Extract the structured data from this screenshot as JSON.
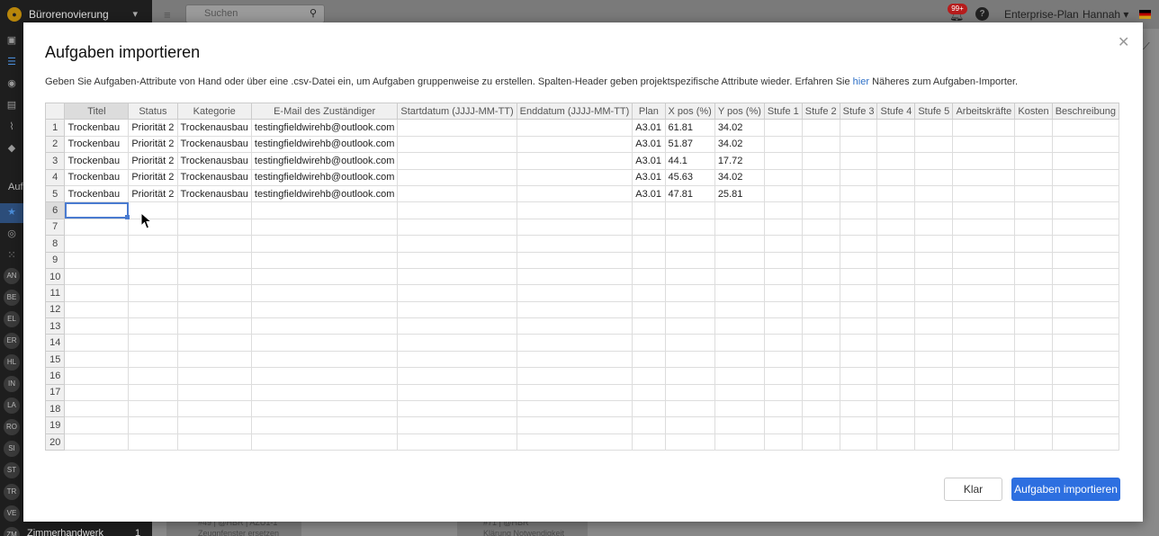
{
  "app": {
    "project_name": "Bürorenovierung",
    "search_placeholder": "Suchen",
    "notification_count": "99+",
    "plan": "Enterprise-Plan",
    "user": "Hannah",
    "sidebar_heading": "Auf",
    "sidebar_badges": [
      "AN",
      "BE",
      "EL",
      "ER",
      "HL",
      "IN",
      "LA",
      "RO",
      "SI",
      "ST",
      "TR",
      "VE",
      "ZM"
    ],
    "sidebar_bottom_item": "Zimmerhandwerk",
    "sidebar_bottom_count": "1",
    "bg_cards": [
      "#49 | @HBR | AZU1-1",
      "Zeugnfenster ersetzen",
      "#71 | @HBR",
      "Klärung Notwendigkeit"
    ]
  },
  "modal": {
    "title": "Aufgaben importieren",
    "description_before": "Geben Sie Aufgaben-Attribute von Hand oder über eine .csv-Datei ein, um Aufgaben gruppenweise zu erstellen. Spalten-Header geben projektspezifische Attribute wieder. Erfahren Sie ",
    "description_link": "hier",
    "description_after": " Näheres zum Aufgaben-Importer.",
    "clear_button": "Klar",
    "import_button": "Aufgaben importieren"
  },
  "grid": {
    "columns": [
      "Titel",
      "Status",
      "Kategorie",
      "E-Mail des Zuständiger",
      "Startdatum (JJJJ-MM-TT)",
      "Enddatum (JJJJ-MM-TT)",
      "Plan",
      "X pos (%)",
      "Y pos (%)",
      "Stufe 1",
      "Stufe 2",
      "Stufe 3",
      "Stufe 4",
      "Stufe 5",
      "Arbeitskräfte",
      "Kosten",
      "Beschreibung"
    ],
    "row_numbers": [
      "1",
      "2",
      "3",
      "4",
      "5",
      "6",
      "7",
      "8",
      "9",
      "10",
      "11",
      "12",
      "13",
      "14",
      "15",
      "16",
      "17",
      "18",
      "19",
      "20"
    ],
    "rows": [
      [
        "Trockenbau",
        "Priorität 2",
        "Trockenausbau",
        "testingfieldwirehb@outlook.com",
        "",
        "",
        "A3.01",
        "61.81",
        "34.02",
        "",
        "",
        "",
        "",
        "",
        "",
        "",
        ""
      ],
      [
        "Trockenbau",
        "Priorität 2",
        "Trockenausbau",
        "testingfieldwirehb@outlook.com",
        "",
        "",
        "A3.01",
        "51.87",
        "34.02",
        "",
        "",
        "",
        "",
        "",
        "",
        "",
        ""
      ],
      [
        "Trockenbau",
        "Priorität 2",
        "Trockenausbau",
        "testingfieldwirehb@outlook.com",
        "",
        "",
        "A3.01",
        "44.1",
        "17.72",
        "",
        "",
        "",
        "",
        "",
        "",
        "",
        ""
      ],
      [
        "Trockenbau",
        "Priorität 2",
        "Trockenausbau",
        "testingfieldwirehb@outlook.com",
        "",
        "",
        "A3.01",
        "45.63",
        "34.02",
        "",
        "",
        "",
        "",
        "",
        "",
        "",
        ""
      ],
      [
        "Trockenbau",
        "Priorität 2",
        "Trockenausbau",
        "testingfieldwirehb@outlook.com",
        "",
        "",
        "A3.01",
        "47.81",
        "25.81",
        "",
        "",
        "",
        "",
        "",
        "",
        "",
        ""
      ]
    ],
    "selected_row": 6,
    "selected_column": "Titel"
  }
}
